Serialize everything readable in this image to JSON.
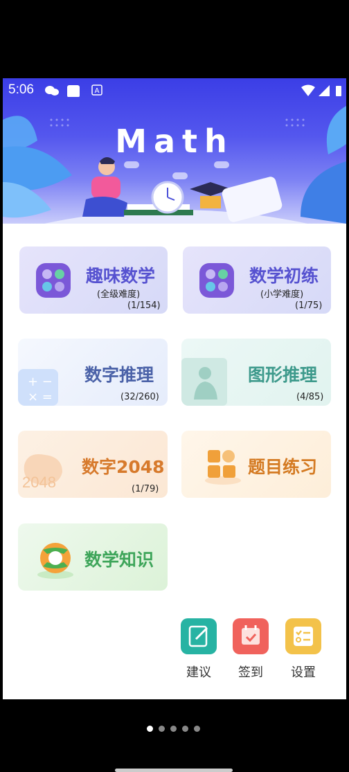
{
  "status_bar": {
    "time": "5:06"
  },
  "banner": {
    "title": "Math"
  },
  "cards": [
    {
      "title": "趣味数学",
      "subtitle": "(全级难度)",
      "count": "(1/154)"
    },
    {
      "title": "数学初练",
      "subtitle": "(小学难度)",
      "count": "(1/75)"
    },
    {
      "title": "数字推理",
      "count": "(32/260)"
    },
    {
      "title": "图形推理",
      "count": "(4/85)"
    },
    {
      "title": "数字2048",
      "count": "(1/79)",
      "decor_text": "2048"
    },
    {
      "title": "题目练习"
    },
    {
      "title": "数学知识"
    }
  ],
  "actions": [
    {
      "label": "建议",
      "icon": "edit-icon",
      "color": "#27b3a3"
    },
    {
      "label": "签到",
      "icon": "calendar-icon",
      "color": "#f0625c"
    },
    {
      "label": "设置",
      "icon": "checklist-icon",
      "color": "#f3c24a"
    }
  ],
  "pager": {
    "count": 5,
    "active": 0
  }
}
